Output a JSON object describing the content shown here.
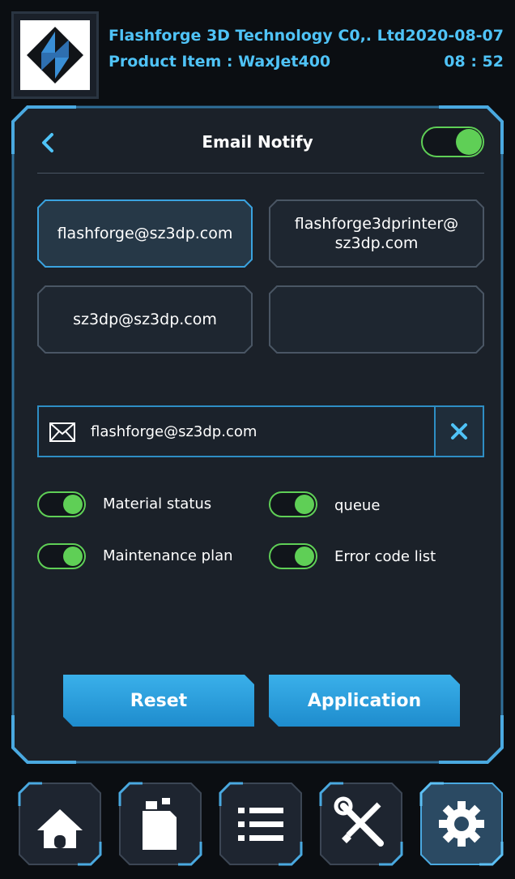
{
  "header": {
    "company": "Flashforge 3D Technology C0,. Ltd",
    "product": "Product Item : WaxJet400",
    "date": "2020-08-07",
    "time": "08 : 52"
  },
  "panel": {
    "title": "Email Notify",
    "master_toggle_on": true,
    "emails": [
      {
        "address": "flashforge@sz3dp.com",
        "selected": true
      },
      {
        "address": "flashforge3dprinter@\nsz3dp.com",
        "selected": false
      },
      {
        "address": "sz3dp@sz3dp.com",
        "selected": false
      },
      {
        "address": "",
        "selected": false
      }
    ],
    "email_input_value": "flashforge@sz3dp.com",
    "options": [
      {
        "label": "Material status",
        "on": true
      },
      {
        "label": "queue",
        "on": true
      },
      {
        "label": "Maintenance plan",
        "on": true
      },
      {
        "label": "Error code list",
        "on": true
      }
    ],
    "reset_label": "Reset",
    "apply_label": "Application"
  },
  "colors": {
    "accent": "#4fc3f7",
    "toggle_on": "#5fcf56",
    "button": "#2a9fe0",
    "background": "#0b0e12"
  },
  "nav": [
    {
      "icon": "home-icon",
      "active": false
    },
    {
      "icon": "material-bottle-icon",
      "active": false
    },
    {
      "icon": "list-icon",
      "active": false
    },
    {
      "icon": "tools-icon",
      "active": false
    },
    {
      "icon": "gear-icon",
      "active": true
    }
  ]
}
